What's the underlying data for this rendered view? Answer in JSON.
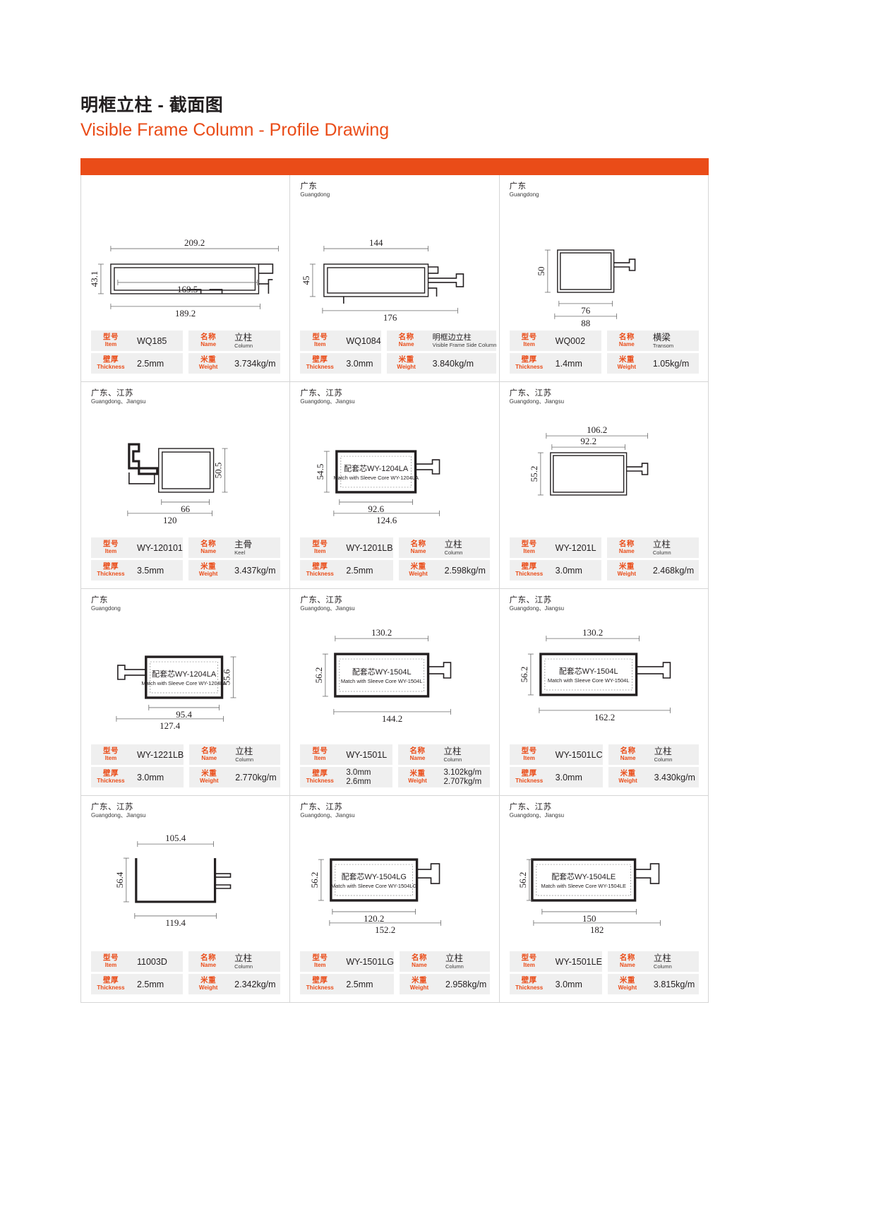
{
  "header": {
    "title_cn": "明框立柱 - 截面图",
    "title_en": "Visible Frame Column - Profile Drawing",
    "accent_color": "#ea4c18"
  },
  "spec_labels": {
    "item_cn": "型号",
    "item_en": "Item",
    "name_cn": "名称",
    "name_en": "Name",
    "thickness_cn": "壁厚",
    "thickness_en": "Thickness",
    "weight_cn": "米重",
    "weight_en": "Weight"
  },
  "cells": [
    {
      "region_cn": "",
      "region_en": "",
      "item": "WQ185",
      "name_cn": "立柱",
      "name_en": "Column",
      "thickness": "2.5mm",
      "weight": "3.734kg/m",
      "dims": {
        "top": "209.2",
        "mid": "169.5",
        "bottom": "189.2",
        "left": "43.1"
      },
      "core": null
    },
    {
      "region_cn": "广东",
      "region_en": "Guangdong",
      "item": "WQ1084",
      "name_cn": "明框边立柱",
      "name_en": "Visible Frame Side Column",
      "thickness": "3.0mm",
      "weight": "3.840kg/m",
      "dims": {
        "top": "144",
        "bottom": "176",
        "left": "45"
      },
      "core": null
    },
    {
      "region_cn": "广东",
      "region_en": "Guangdong",
      "item": "WQ002",
      "name_cn": "横梁",
      "name_en": "Transom",
      "thickness": "1.4mm",
      "weight": "1.05kg/m",
      "dims": {
        "mid": "76",
        "bottom": "88",
        "left": "50"
      },
      "core": null
    },
    {
      "region_cn": "广东、江苏",
      "region_en": "Guangdong、Jiangsu",
      "item": "WY-120101",
      "name_cn": "主骨",
      "name_en": "Keel",
      "thickness": "3.5mm",
      "weight": "3.437kg/m",
      "dims": {
        "mid": "66",
        "bottom": "120",
        "right": "50.5"
      },
      "core": null
    },
    {
      "region_cn": "广东、江苏",
      "region_en": "Guangdong、Jiangsu",
      "item": "WY-1201LB",
      "name_cn": "立柱",
      "name_en": "Column",
      "thickness": "2.5mm",
      "weight": "2.598kg/m",
      "dims": {
        "mid": "92.6",
        "bottom": "124.6",
        "left": "54.5"
      },
      "core": {
        "cn": "配套芯WY-1204LA",
        "en": "Match with Sleeve Core WY-1204LA"
      }
    },
    {
      "region_cn": "广东、江苏",
      "region_en": "Guangdong、Jiangsu",
      "item": "WY-1201L",
      "name_cn": "立柱",
      "name_en": "Column",
      "thickness": "3.0mm",
      "weight": "2.468kg/m",
      "dims": {
        "top": "106.2",
        "mid": "92.2",
        "left": "55.2"
      },
      "core": null
    },
    {
      "region_cn": "广东",
      "region_en": "Guangdong",
      "item": "WY-1221LB",
      "name_cn": "立柱",
      "name_en": "Column",
      "thickness": "3.0mm",
      "weight": "2.770kg/m",
      "dims": {
        "mid": "95.4",
        "bottom": "127.4",
        "right": "55.6"
      },
      "core": {
        "cn": "配套芯WY-1204LA",
        "en": "Match with Sleeve Core WY-1204LA"
      }
    },
    {
      "region_cn": "广东、江苏",
      "region_en": "Guangdong、Jiangsu",
      "item": "WY-1501L",
      "name_cn": "立柱",
      "name_en": "Column",
      "thickness": "3.0mm",
      "thickness2": "2.6mm",
      "weight": "3.102kg/m",
      "weight2": "2.707kg/m",
      "dims": {
        "top": "130.2",
        "bottom": "144.2",
        "left": "56.2"
      },
      "core": {
        "cn": "配套芯WY-1504L",
        "en": "Match with Sleeve Core WY-1504L"
      }
    },
    {
      "region_cn": "广东、江苏",
      "region_en": "Guangdong、Jiangsu",
      "item": "WY-1501LC",
      "name_cn": "立柱",
      "name_en": "Column",
      "thickness": "3.0mm",
      "weight": "3.430kg/m",
      "dims": {
        "top": "130.2",
        "bottom": "162.2",
        "left": "56.2"
      },
      "core": {
        "cn": "配套芯WY-1504L",
        "en": "Match with Sleeve Core WY-1504L"
      }
    },
    {
      "region_cn": "广东、江苏",
      "region_en": "Guangdong、Jiangsu",
      "item": "11003D",
      "name_cn": "立柱",
      "name_en": "Column",
      "thickness": "2.5mm",
      "weight": "2.342kg/m",
      "dims": {
        "top": "105.4",
        "bottom": "119.4",
        "left": "56.4"
      },
      "core": null
    },
    {
      "region_cn": "广东、江苏",
      "region_en": "Guangdong、Jiangsu",
      "item": "WY-1501LG",
      "name_cn": "立柱",
      "name_en": "Column",
      "thickness": "2.5mm",
      "weight": "2.958kg/m",
      "dims": {
        "mid": "120.2",
        "bottom": "152.2",
        "left": "56.2"
      },
      "core": {
        "cn": "配套芯WY-1504LG",
        "en": "Match with Sleeve Core WY-1504LG"
      }
    },
    {
      "region_cn": "广东、江苏",
      "region_en": "Guangdong、Jiangsu",
      "item": "WY-1501LE",
      "name_cn": "立柱",
      "name_en": "Column",
      "thickness": "3.0mm",
      "weight": "3.815kg/m",
      "dims": {
        "mid": "150",
        "bottom": "182",
        "left": "56.2"
      },
      "core": {
        "cn": "配套芯WY-1504LE",
        "en": "Match with Sleeve Core WY-1504LE"
      }
    }
  ]
}
